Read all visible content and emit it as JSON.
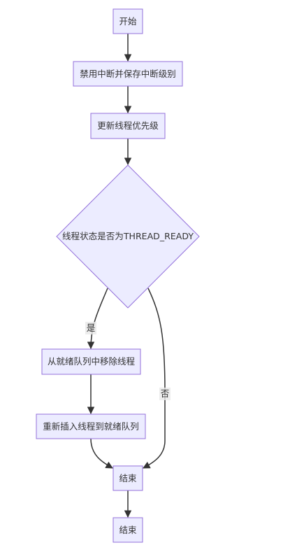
{
  "flowchart": {
    "nodes": {
      "start": "开始",
      "disable_irq": "禁用中断并保存中断级别",
      "update_priority": "更新线程优先级",
      "check_ready": "线程状态是否为THREAD_READY",
      "remove_ready": "从就绪队列中移除线程",
      "reinsert_ready": "重新插入线程到就绪队列",
      "end_1": "结束",
      "end_2": "结束"
    },
    "edges": {
      "yes_label": "是",
      "no_label": "否"
    }
  },
  "colors": {
    "node_fill": "#ececff",
    "node_stroke": "#9370db",
    "edge": "#333333"
  }
}
